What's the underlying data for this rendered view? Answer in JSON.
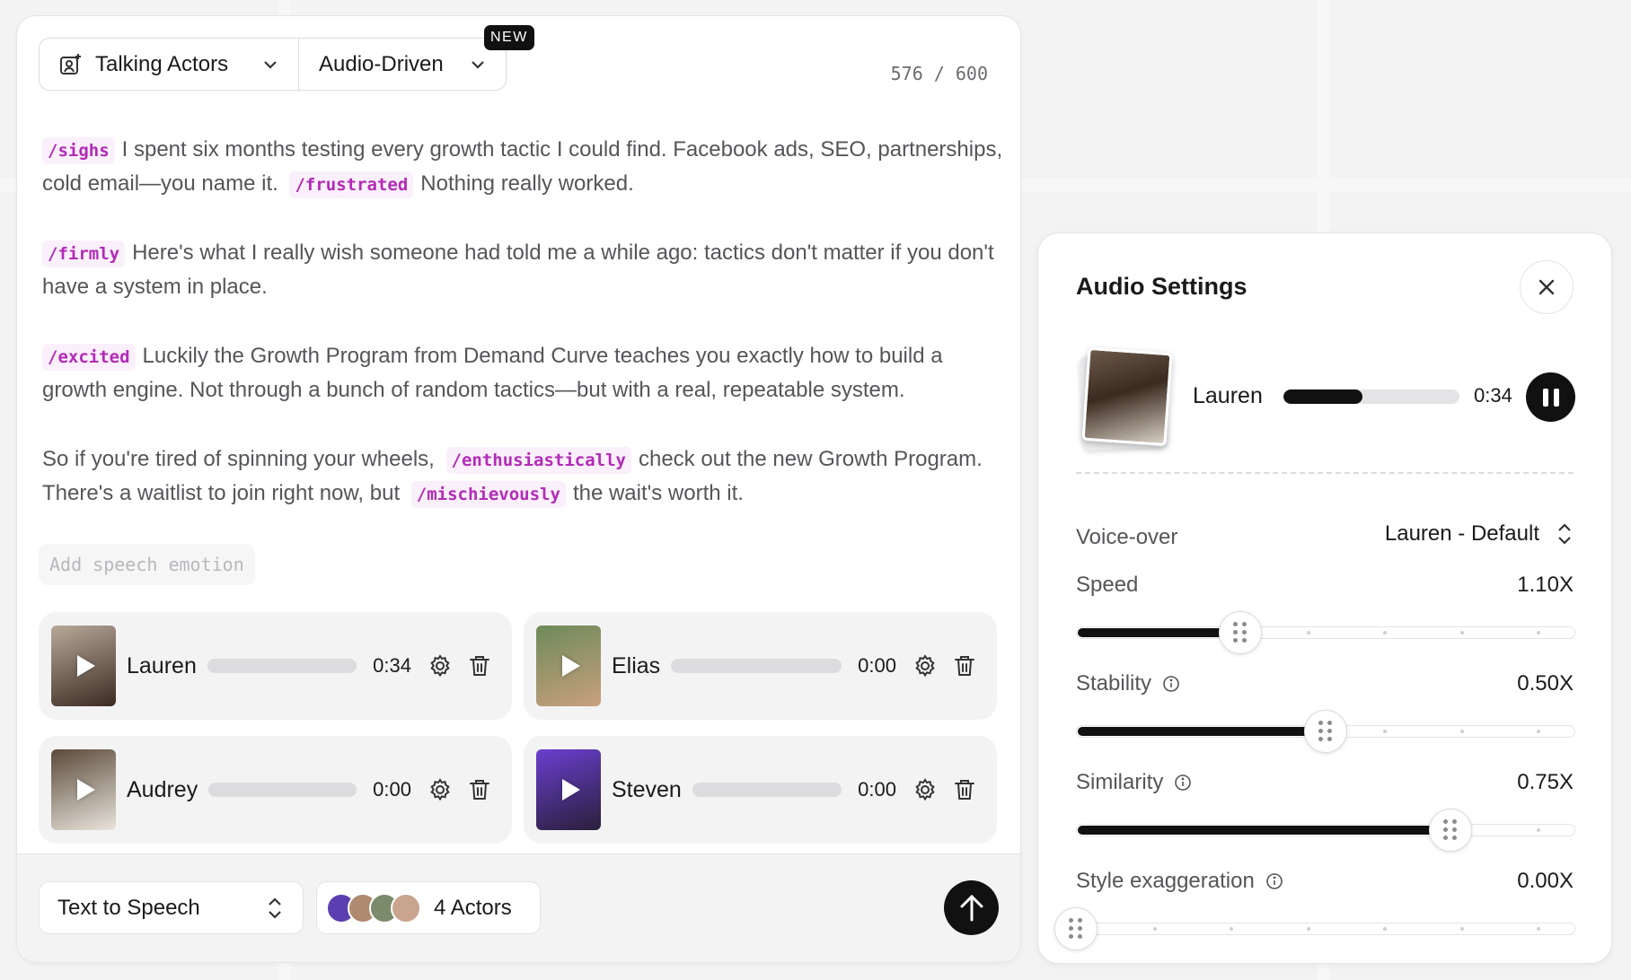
{
  "composer": {
    "mode_primary": "Talking Actors",
    "mode_secondary": "Audio-Driven",
    "new_badge": "NEW",
    "char_count": "576 / 600",
    "script": {
      "p1": {
        "tag1": "/sighs",
        "text1": "I spent six months testing every growth tactic I could find. Facebook ads, SEO, partnerships, cold email—you name it.",
        "tag2": "/frustrated",
        "text2": "Nothing really worked."
      },
      "p2": {
        "tag1": "/firmly",
        "text1": "Here's what I really wish someone had told me a while ago: tactics don't matter if you don't have a system in place."
      },
      "p3": {
        "tag1": "/excited",
        "text1": "Luckily the Growth Program from Demand Curve teaches you exactly how to build a growth engine. Not through a bunch of random tactics—but with a real, repeatable system."
      },
      "p4": {
        "text1": "So if you're tired of spinning your wheels,",
        "tag1": "/enthusiastically",
        "text2": "check out the new Growth Program. There's a waitlist to join right now, but",
        "tag2": "/mischievously",
        "text3": "the wait's worth it."
      }
    },
    "add_emotion_placeholder": "Add speech emotion",
    "actors": [
      {
        "name": "Lauren",
        "time": "0:34",
        "colors": [
          "#b9a99a",
          "#3a2a22"
        ]
      },
      {
        "name": "Elias",
        "time": "0:00",
        "colors": [
          "#6d8a5a",
          "#c9a07e"
        ]
      },
      {
        "name": "Audrey",
        "time": "0:00",
        "colors": [
          "#5a4a3a",
          "#e9e4dc"
        ]
      },
      {
        "name": "Steven",
        "time": "0:00",
        "colors": [
          "#6a3fd0",
          "#2a1f3a"
        ]
      }
    ],
    "footer": {
      "tts_label": "Text to Speech",
      "actors_label": "4 Actors",
      "avatar_colors": [
        "#5b3fb0",
        "#b08a70",
        "#7a8a6a",
        "#c9a58f"
      ]
    }
  },
  "settings": {
    "title": "Audio Settings",
    "preview": {
      "name": "Lauren",
      "time": "0:34",
      "progress": 0.45
    },
    "voiceover_label": "Voice-over",
    "voiceover_value": "Lauren - Default",
    "sliders": [
      {
        "label": "Speed",
        "value": "1.10X",
        "info": false,
        "fraction": 0.33
      },
      {
        "label": "Stability",
        "value": "0.50X",
        "info": true,
        "fraction": 0.5
      },
      {
        "label": "Similarity",
        "value": "0.75X",
        "info": true,
        "fraction": 0.75
      },
      {
        "label": "Style exaggeration",
        "value": "0.00X",
        "info": true,
        "fraction": 0.0
      }
    ]
  },
  "colors": {
    "accent": "#111111",
    "tag_text": "#b32ab8",
    "tag_bg": "#faf0fb"
  }
}
